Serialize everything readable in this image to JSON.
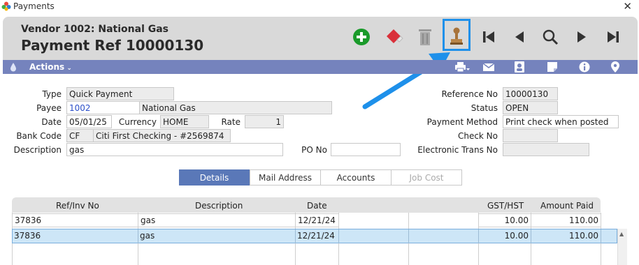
{
  "window": {
    "title": "Payments",
    "close": "✕"
  },
  "header": {
    "vendor": "Vendor 1002: National Gas",
    "payment_ref": "Payment Ref 10000130"
  },
  "toolbar": {
    "icons": [
      "add-icon",
      "eraser-icon",
      "trash-icon",
      "stamp-icon",
      "first-record-icon",
      "previous-record-icon",
      "search-icon",
      "next-record-icon",
      "last-record-icon"
    ],
    "colors": {
      "add": "#1a9a2a",
      "eraser": "#d9303a",
      "accent_highlight": "#1e90ea"
    }
  },
  "actions_bar": {
    "label": "Actions",
    "icons": [
      "print-icon",
      "mail-icon",
      "contact-card-icon",
      "note-icon",
      "info-icon",
      "location-pin-icon"
    ],
    "color": "#7583bd"
  },
  "form": {
    "type_label": "Type",
    "type_value": "Quick Payment",
    "payee_label": "Payee",
    "payee_code": "1002",
    "payee_name": "National Gas",
    "date_label": "Date",
    "date_value": "05/01/25",
    "currency_label": "Currency",
    "currency_value": "HOME",
    "rate_label": "Rate",
    "rate_value": "1",
    "bank_label": "Bank Code",
    "bank_code": "CF",
    "bank_name": "Citi First Checking - #2569874",
    "description_label": "Description",
    "description_value": "gas",
    "po_label": "PO No",
    "po_value": "",
    "reference_label": "Reference No",
    "reference_value": "10000130",
    "status_label": "Status",
    "status_value": "OPEN",
    "payment_method_label": "Payment Method",
    "payment_method_value": "Print check when posted",
    "check_label": "Check No",
    "check_value": "",
    "eft_label": "Electronic Trans No",
    "eft_value": ""
  },
  "tabs": [
    {
      "label": "Details",
      "active": true
    },
    {
      "label": "Mail Address",
      "active": false
    },
    {
      "label": "Accounts",
      "active": false
    },
    {
      "label": "Job Cost",
      "disabled": true
    }
  ],
  "grid": {
    "columns": [
      "Ref/Inv No",
      "Description",
      "Date",
      "GST/HST",
      "Amount Paid"
    ],
    "rows": [
      [
        "37836",
        "gas",
        "12/21/24",
        "10.00",
        "110.00"
      ],
      [
        "37836",
        "gas",
        "12/21/24",
        "10.00",
        "110.00"
      ]
    ]
  }
}
